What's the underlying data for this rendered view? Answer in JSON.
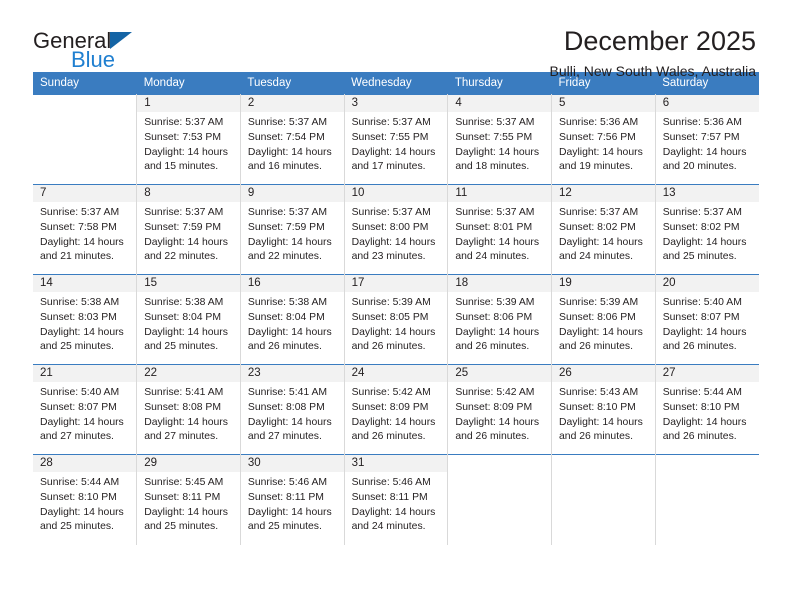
{
  "brand": {
    "name_part1": "General",
    "name_part2": "Blue",
    "accent_color": "#1f7fd0",
    "triangle_color": "#1464a5"
  },
  "header": {
    "month_title": "December 2025",
    "location": "Bulli, New South Wales, Australia"
  },
  "calendar": {
    "header_bg": "#3a7cc0",
    "weekdays": [
      "Sunday",
      "Monday",
      "Tuesday",
      "Wednesday",
      "Thursday",
      "Friday",
      "Saturday"
    ],
    "labels": {
      "sunrise": "Sunrise:",
      "sunset": "Sunset:",
      "daylight": "Daylight:"
    },
    "weeks": [
      [
        {
          "day": ""
        },
        {
          "day": "1",
          "sunrise": "Sunrise: 5:37 AM",
          "sunset": "Sunset: 7:53 PM",
          "daylight_line1": "Daylight: 14 hours",
          "daylight_line2": "and 15 minutes."
        },
        {
          "day": "2",
          "sunrise": "Sunrise: 5:37 AM",
          "sunset": "Sunset: 7:54 PM",
          "daylight_line1": "Daylight: 14 hours",
          "daylight_line2": "and 16 minutes."
        },
        {
          "day": "3",
          "sunrise": "Sunrise: 5:37 AM",
          "sunset": "Sunset: 7:55 PM",
          "daylight_line1": "Daylight: 14 hours",
          "daylight_line2": "and 17 minutes."
        },
        {
          "day": "4",
          "sunrise": "Sunrise: 5:37 AM",
          "sunset": "Sunset: 7:55 PM",
          "daylight_line1": "Daylight: 14 hours",
          "daylight_line2": "and 18 minutes."
        },
        {
          "day": "5",
          "sunrise": "Sunrise: 5:36 AM",
          "sunset": "Sunset: 7:56 PM",
          "daylight_line1": "Daylight: 14 hours",
          "daylight_line2": "and 19 minutes."
        },
        {
          "day": "6",
          "sunrise": "Sunrise: 5:36 AM",
          "sunset": "Sunset: 7:57 PM",
          "daylight_line1": "Daylight: 14 hours",
          "daylight_line2": "and 20 minutes."
        }
      ],
      [
        {
          "day": "7",
          "sunrise": "Sunrise: 5:37 AM",
          "sunset": "Sunset: 7:58 PM",
          "daylight_line1": "Daylight: 14 hours",
          "daylight_line2": "and 21 minutes."
        },
        {
          "day": "8",
          "sunrise": "Sunrise: 5:37 AM",
          "sunset": "Sunset: 7:59 PM",
          "daylight_line1": "Daylight: 14 hours",
          "daylight_line2": "and 22 minutes."
        },
        {
          "day": "9",
          "sunrise": "Sunrise: 5:37 AM",
          "sunset": "Sunset: 7:59 PM",
          "daylight_line1": "Daylight: 14 hours",
          "daylight_line2": "and 22 minutes."
        },
        {
          "day": "10",
          "sunrise": "Sunrise: 5:37 AM",
          "sunset": "Sunset: 8:00 PM",
          "daylight_line1": "Daylight: 14 hours",
          "daylight_line2": "and 23 minutes."
        },
        {
          "day": "11",
          "sunrise": "Sunrise: 5:37 AM",
          "sunset": "Sunset: 8:01 PM",
          "daylight_line1": "Daylight: 14 hours",
          "daylight_line2": "and 24 minutes."
        },
        {
          "day": "12",
          "sunrise": "Sunrise: 5:37 AM",
          "sunset": "Sunset: 8:02 PM",
          "daylight_line1": "Daylight: 14 hours",
          "daylight_line2": "and 24 minutes."
        },
        {
          "day": "13",
          "sunrise": "Sunrise: 5:37 AM",
          "sunset": "Sunset: 8:02 PM",
          "daylight_line1": "Daylight: 14 hours",
          "daylight_line2": "and 25 minutes."
        }
      ],
      [
        {
          "day": "14",
          "sunrise": "Sunrise: 5:38 AM",
          "sunset": "Sunset: 8:03 PM",
          "daylight_line1": "Daylight: 14 hours",
          "daylight_line2": "and 25 minutes."
        },
        {
          "day": "15",
          "sunrise": "Sunrise: 5:38 AM",
          "sunset": "Sunset: 8:04 PM",
          "daylight_line1": "Daylight: 14 hours",
          "daylight_line2": "and 25 minutes."
        },
        {
          "day": "16",
          "sunrise": "Sunrise: 5:38 AM",
          "sunset": "Sunset: 8:04 PM",
          "daylight_line1": "Daylight: 14 hours",
          "daylight_line2": "and 26 minutes."
        },
        {
          "day": "17",
          "sunrise": "Sunrise: 5:39 AM",
          "sunset": "Sunset: 8:05 PM",
          "daylight_line1": "Daylight: 14 hours",
          "daylight_line2": "and 26 minutes."
        },
        {
          "day": "18",
          "sunrise": "Sunrise: 5:39 AM",
          "sunset": "Sunset: 8:06 PM",
          "daylight_line1": "Daylight: 14 hours",
          "daylight_line2": "and 26 minutes."
        },
        {
          "day": "19",
          "sunrise": "Sunrise: 5:39 AM",
          "sunset": "Sunset: 8:06 PM",
          "daylight_line1": "Daylight: 14 hours",
          "daylight_line2": "and 26 minutes."
        },
        {
          "day": "20",
          "sunrise": "Sunrise: 5:40 AM",
          "sunset": "Sunset: 8:07 PM",
          "daylight_line1": "Daylight: 14 hours",
          "daylight_line2": "and 26 minutes."
        }
      ],
      [
        {
          "day": "21",
          "sunrise": "Sunrise: 5:40 AM",
          "sunset": "Sunset: 8:07 PM",
          "daylight_line1": "Daylight: 14 hours",
          "daylight_line2": "and 27 minutes."
        },
        {
          "day": "22",
          "sunrise": "Sunrise: 5:41 AM",
          "sunset": "Sunset: 8:08 PM",
          "daylight_line1": "Daylight: 14 hours",
          "daylight_line2": "and 27 minutes."
        },
        {
          "day": "23",
          "sunrise": "Sunrise: 5:41 AM",
          "sunset": "Sunset: 8:08 PM",
          "daylight_line1": "Daylight: 14 hours",
          "daylight_line2": "and 27 minutes."
        },
        {
          "day": "24",
          "sunrise": "Sunrise: 5:42 AM",
          "sunset": "Sunset: 8:09 PM",
          "daylight_line1": "Daylight: 14 hours",
          "daylight_line2": "and 26 minutes."
        },
        {
          "day": "25",
          "sunrise": "Sunrise: 5:42 AM",
          "sunset": "Sunset: 8:09 PM",
          "daylight_line1": "Daylight: 14 hours",
          "daylight_line2": "and 26 minutes."
        },
        {
          "day": "26",
          "sunrise": "Sunrise: 5:43 AM",
          "sunset": "Sunset: 8:10 PM",
          "daylight_line1": "Daylight: 14 hours",
          "daylight_line2": "and 26 minutes."
        },
        {
          "day": "27",
          "sunrise": "Sunrise: 5:44 AM",
          "sunset": "Sunset: 8:10 PM",
          "daylight_line1": "Daylight: 14 hours",
          "daylight_line2": "and 26 minutes."
        }
      ],
      [
        {
          "day": "28",
          "sunrise": "Sunrise: 5:44 AM",
          "sunset": "Sunset: 8:10 PM",
          "daylight_line1": "Daylight: 14 hours",
          "daylight_line2": "and 25 minutes."
        },
        {
          "day": "29",
          "sunrise": "Sunrise: 5:45 AM",
          "sunset": "Sunset: 8:11 PM",
          "daylight_line1": "Daylight: 14 hours",
          "daylight_line2": "and 25 minutes."
        },
        {
          "day": "30",
          "sunrise": "Sunrise: 5:46 AM",
          "sunset": "Sunset: 8:11 PM",
          "daylight_line1": "Daylight: 14 hours",
          "daylight_line2": "and 25 minutes."
        },
        {
          "day": "31",
          "sunrise": "Sunrise: 5:46 AM",
          "sunset": "Sunset: 8:11 PM",
          "daylight_line1": "Daylight: 14 hours",
          "daylight_line2": "and 24 minutes."
        },
        {
          "day": ""
        },
        {
          "day": ""
        },
        {
          "day": ""
        }
      ]
    ]
  }
}
